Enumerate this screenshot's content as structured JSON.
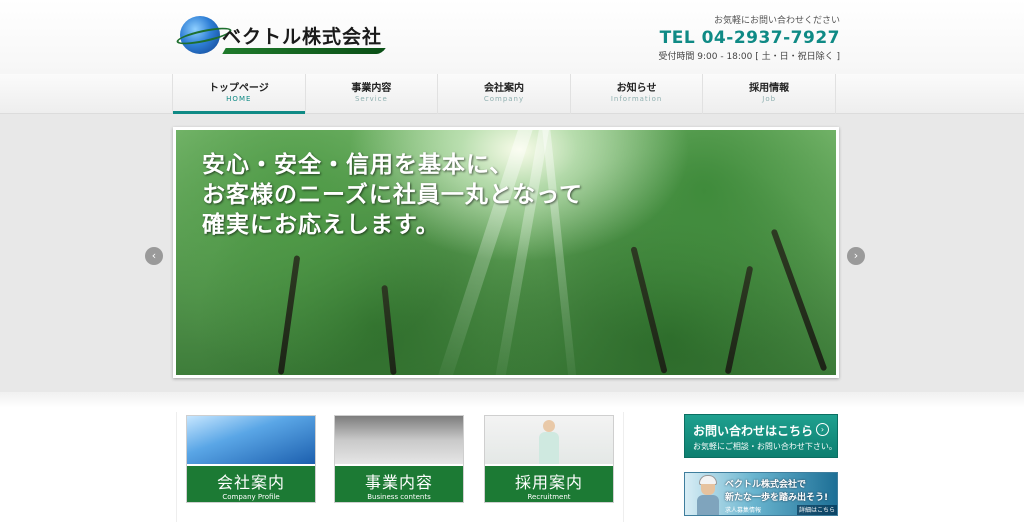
{
  "header": {
    "company_name": "ベクトル株式会社",
    "contact_note": "お気軽にお問い合わせください",
    "tel": "TEL 04-2937-7927",
    "hours": "受付時間 9:00 - 18:00 [ 土・日・祝日除く ]"
  },
  "nav": [
    {
      "jp": "トップページ",
      "en": "HOME"
    },
    {
      "jp": "事業内容",
      "en": "Service"
    },
    {
      "jp": "会社案内",
      "en": "Company"
    },
    {
      "jp": "お知らせ",
      "en": "Information"
    },
    {
      "jp": "採用情報",
      "en": "Job"
    }
  ],
  "slider": {
    "line1": "安心・安全・信用を基本に、",
    "line2": "お客様のニーズに社員一丸となって",
    "line3": "確実にお応えします。",
    "prev_icon": "‹",
    "next_icon": "›"
  },
  "cards": [
    {
      "jp": "会社案内",
      "en": "Company Profile"
    },
    {
      "jp": "事業内容",
      "en": "Business contents"
    },
    {
      "jp": "採用案内",
      "en": "Recruitment"
    }
  ],
  "banner_contact": {
    "title": "お問い合わせはこちら",
    "sub": "お気軽にご相談・お問い合わせ下さい。",
    "icon": "›"
  },
  "banner_recruit": {
    "line1": "ベクトル株式会社で",
    "line2": "新たな一歩を踏み出そう!",
    "line3": "求人募集情報",
    "more": "詳細はこちら>>"
  },
  "colors": {
    "accent": "#0f8a85",
    "card_green": "#1c7a34"
  }
}
